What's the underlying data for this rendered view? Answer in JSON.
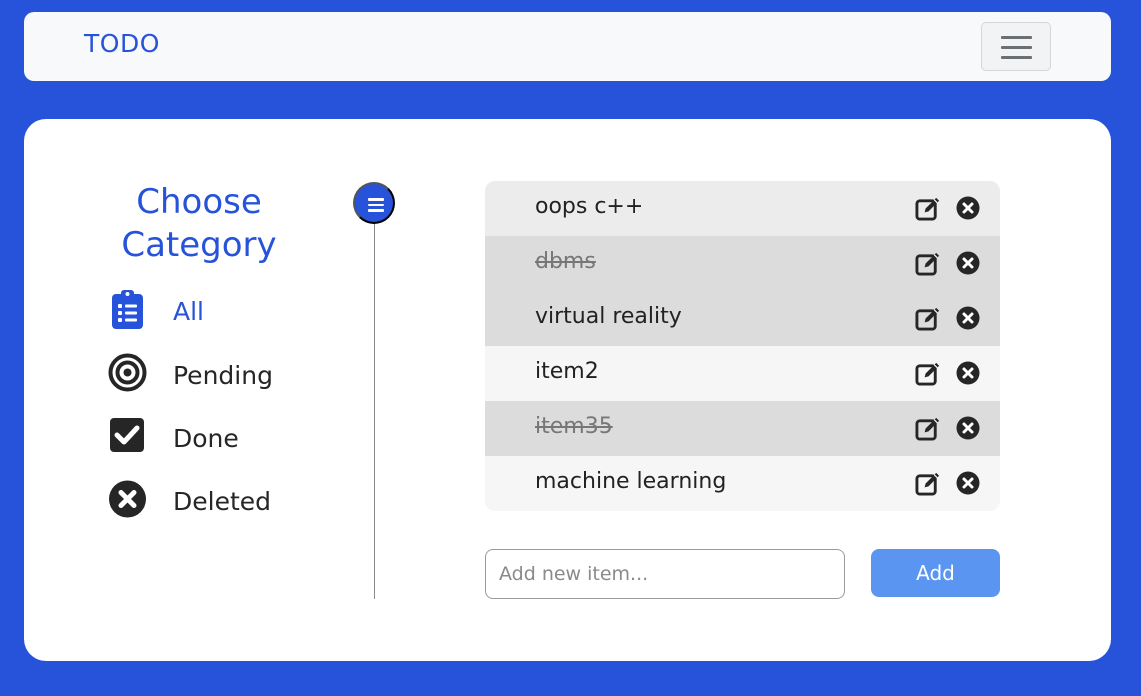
{
  "navbar": {
    "brand": "TODO",
    "menu_icon": "hamburger-icon"
  },
  "sidebar": {
    "title_line1": "Choose",
    "title_line2": "Category",
    "items": [
      {
        "label": "All",
        "icon": "clipboard-list-icon",
        "active": true
      },
      {
        "label": "Pending",
        "icon": "target-icon",
        "active": false
      },
      {
        "label": "Done",
        "icon": "checkbox-checked-icon",
        "active": false
      },
      {
        "label": "Deleted",
        "icon": "circle-x-icon",
        "active": false
      }
    ]
  },
  "todos": [
    {
      "text": "oops c++",
      "done": false
    },
    {
      "text": "dbms",
      "done": true
    },
    {
      "text": "virtual reality",
      "done": false
    },
    {
      "text": "item2",
      "done": false
    },
    {
      "text": "item35",
      "done": true
    },
    {
      "text": "machine learning",
      "done": false
    }
  ],
  "add_form": {
    "placeholder": "Add new item...",
    "button_label": "Add"
  },
  "colors": {
    "brand": "#2653d9",
    "add_button": "#5b95f2",
    "row_backgrounds": [
      "#ececec",
      "#dcdcdc",
      "#dcdcdc",
      "#f6f6f6",
      "#dcdcdc",
      "#f6f6f6"
    ]
  }
}
